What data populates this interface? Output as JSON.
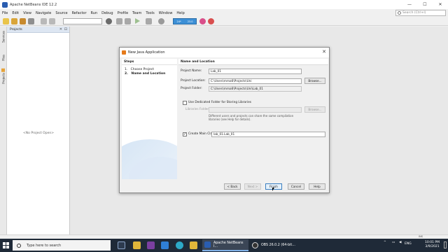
{
  "window": {
    "title": "Apache NetBeans IDE 12.2",
    "controls": {
      "minimize": "—",
      "maximize": "☐",
      "close": "✕"
    }
  },
  "menu": [
    "File",
    "Edit",
    "View",
    "Navigate",
    "Source",
    "Refactor",
    "Run",
    "Debug",
    "Profile",
    "Team",
    "Tools",
    "Window",
    "Help"
  ],
  "search": {
    "placeholder": "Search (Ctrl+I)"
  },
  "memory_widget": {
    "left": "24*",
    "right": "23.0"
  },
  "side_tabs": [
    "Services",
    "Files",
    "Projects"
  ],
  "projects_panel": {
    "title": "Projects",
    "close": "✕",
    "maximize": "⊡",
    "empty_text": "<No Project Open>"
  },
  "dialog": {
    "title": "New Java Application",
    "close": "✕",
    "steps_header": "Steps",
    "steps": [
      {
        "num": "1.",
        "label": "Choose Project"
      },
      {
        "num": "2.",
        "label": "Name and Location"
      }
    ],
    "content_header": "Name and Location",
    "project_name_label": "Project Name:",
    "project_name_value": "Lab_01",
    "project_location_label": "Project Location:",
    "project_location_value": "C:\\Users\\mma6\\Projects\\Uni",
    "browse_label": "Browse...",
    "project_folder_label": "Project Folder:",
    "project_folder_value": "C:\\Users\\mma6\\Projects\\Uni\\Lab_01",
    "dedicated_folder_label": "Use Dedicated Folder for Storing Libraries",
    "dedicated_folder_checked": false,
    "libraries_folder_label": "Libraries Folder:",
    "libraries_folder_value": "",
    "libraries_browse_label": "Browse...",
    "libraries_note": [
      "Different users and projects can share the same compilation",
      "libraries (see Help for details)."
    ],
    "create_main_label": "Create Main Class",
    "create_main_checked": true,
    "main_class_value": "lab_01.Lab_01",
    "buttons": {
      "back": "< Back",
      "next": "Next >",
      "finish": "Finish",
      "cancel": "Cancel",
      "help": "Help"
    }
  },
  "statusbar": {
    "mode": "INS"
  },
  "taskbar": {
    "search_placeholder": "Type here to search",
    "tasks": [
      {
        "label": "Apache NetBeans I...",
        "active": true
      },
      {
        "label": "OBS 26.0.2 (64-bit...",
        "active": false
      }
    ],
    "tray": {
      "language": "ENG"
    },
    "clock": {
      "time": "10:01 PM",
      "date": "3/9/2021"
    }
  },
  "colors": {
    "accent": "#3c7fc0",
    "taskbar_bg": "#1f2a38",
    "panel_header": "#dde6f2"
  }
}
